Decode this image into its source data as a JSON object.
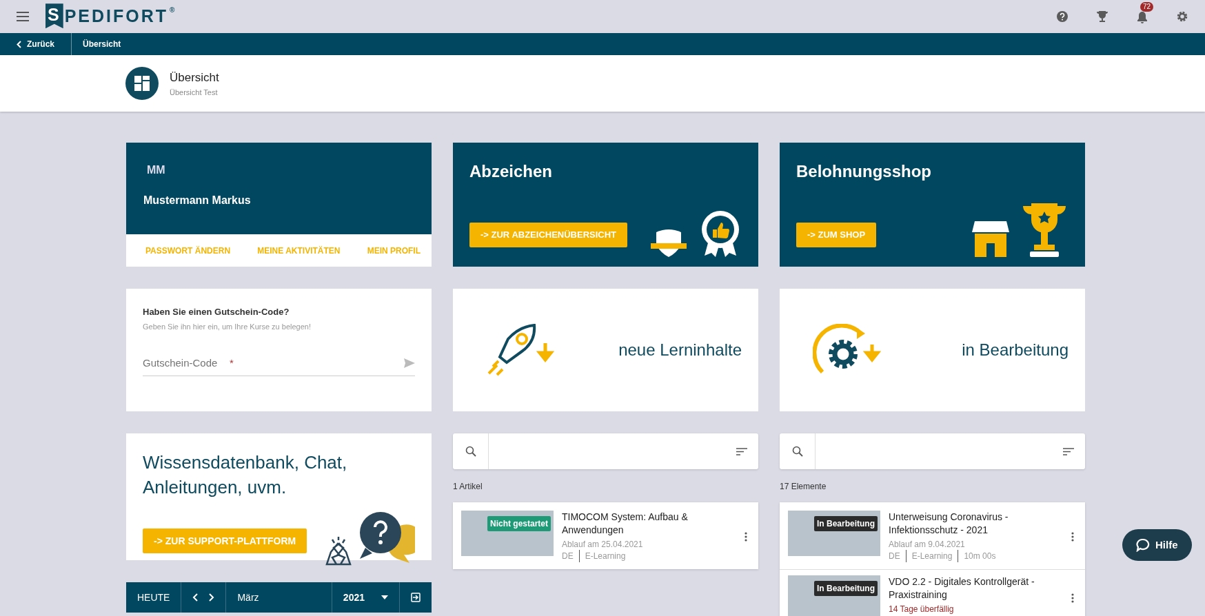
{
  "topbar": {
    "logo": "SPEDIFORT",
    "logo_mark": "®",
    "notification_count": "72"
  },
  "breadcrumb": {
    "back": "Zurück",
    "current": "Übersicht"
  },
  "header": {
    "title": "Übersicht",
    "subtitle": "Übersicht Test"
  },
  "profile": {
    "initials": "MM",
    "name": "Mustermann Markus",
    "links": [
      "PASSWORT ÄNDERN",
      "MEINE AKTIVITÄTEN",
      "MEIN PROFIL"
    ]
  },
  "badges_card": {
    "title": "Abzeichen",
    "button": "-> ZUR ABZEICHENÜBERSICHT",
    "kind": "badges"
  },
  "shop_card": {
    "title": "Belohnungsshop",
    "button": "-> ZUM SHOP",
    "kind": "shop"
  },
  "voucher": {
    "title": "Haben Sie einen Gutschein-Code?",
    "hint": "Geben Sie ihn hier ein, um Ihre Kurse zu belegen!",
    "placeholder": "Gutschein-Code",
    "required_mark": "*"
  },
  "tiles": [
    {
      "label": "neue Lerninhalte",
      "kind": "rocket"
    },
    {
      "label": "in Bearbeitung",
      "kind": "gear"
    }
  ],
  "support": {
    "title": "Wissensdatenbank, Chat, Anleitungen, uvm.",
    "button": "-> ZUR SUPPORT-PLATTFORM"
  },
  "calendar": {
    "today": "HEUTE",
    "month": "März",
    "year": "2021"
  },
  "lists": [
    {
      "count": "1 Artikel",
      "items": [
        {
          "title": "TIMOCOM System: Aufbau & Anwendungen",
          "status": "Nicht gestartet",
          "kind": "not_started",
          "info": "Ablauf am 25.04.2021",
          "overdue": false,
          "tags": [
            "DE",
            "E-Learning"
          ]
        }
      ]
    },
    {
      "count": "17 Elemente",
      "items": [
        {
          "title": "Unterweisung Coronavirus - Infektionsschutz - 2021",
          "status": "In Bearbeitung",
          "kind": "in_progress",
          "info": "Ablauf am 9.04.2021",
          "overdue": false,
          "tags": [
            "DE",
            "E-Learning",
            "10m 00s"
          ]
        },
        {
          "title": "VDO 2.2 - Digitales Kontrollgerät - Praxistraining",
          "status": "In Bearbeitung",
          "kind": "in_progress",
          "info": "14 Tage überfällig",
          "overdue": true
        }
      ]
    }
  ],
  "help_button": "Hilfe"
}
